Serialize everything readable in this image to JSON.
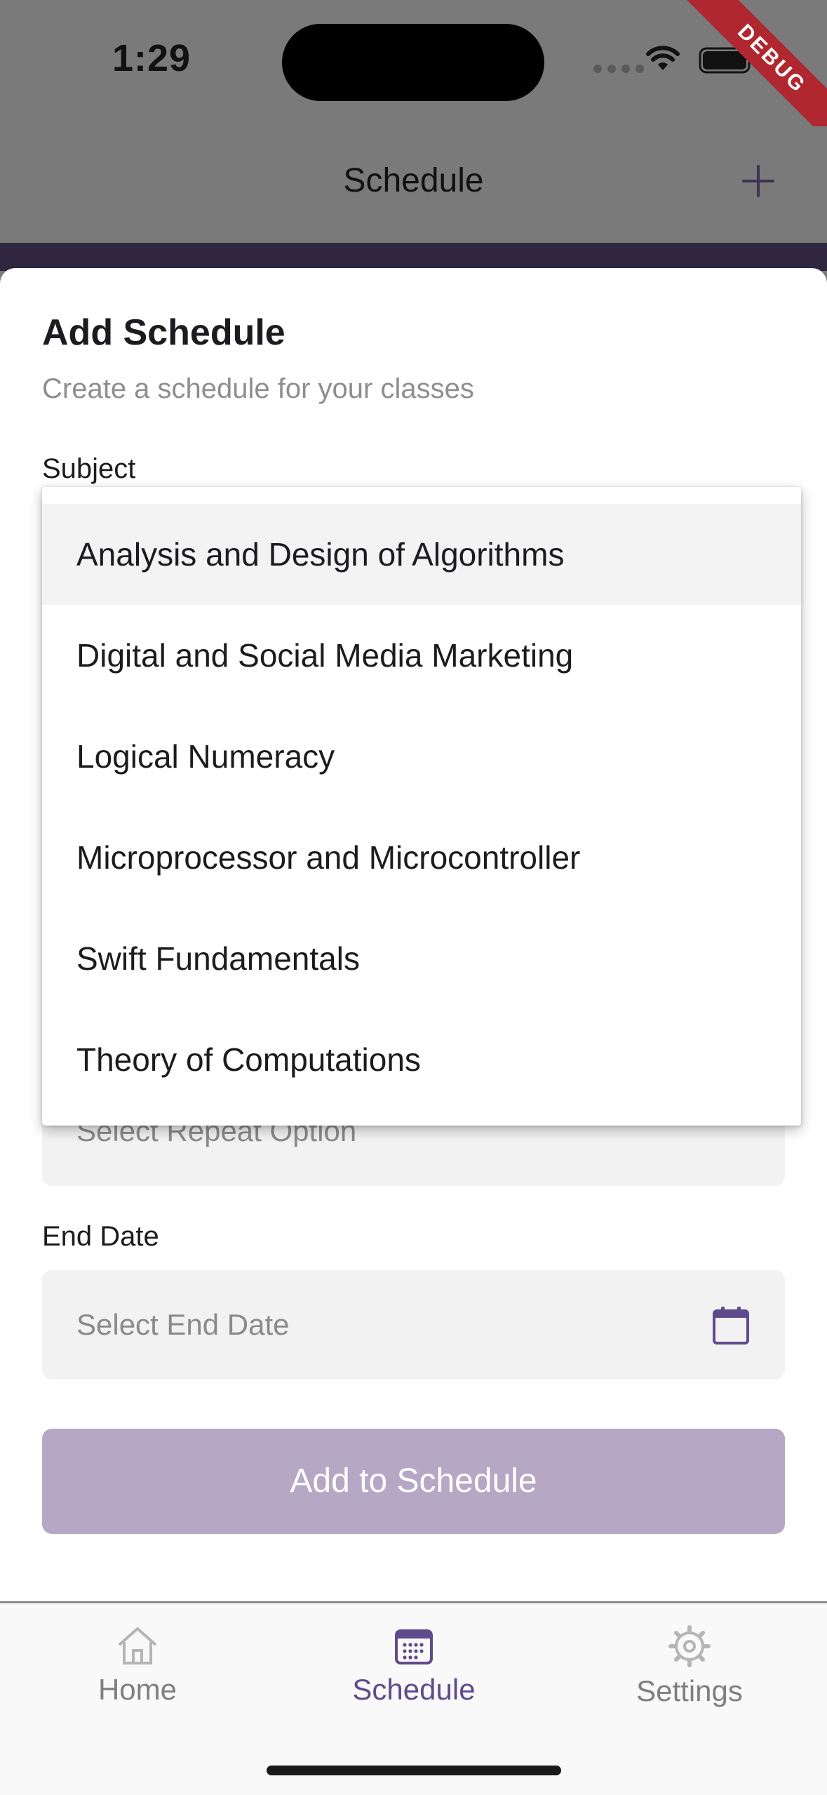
{
  "status_bar": {
    "time": "1:29",
    "debug_label": "DEBUG"
  },
  "app_bar": {
    "title": "Schedule",
    "add_icon": "plus-icon"
  },
  "sheet": {
    "title": "Add Schedule",
    "subtitle": "Create a schedule for your classes",
    "subject_label": "Subject",
    "repeat_placeholder": "Select Repeat Option",
    "end_date_label": "End Date",
    "end_date_placeholder": "Select End Date",
    "submit_label": "Add to Schedule"
  },
  "dropdown": {
    "items": [
      "Analysis and Design of Algorithms",
      "Digital and Social Media Marketing",
      "Logical Numeracy",
      "Microprocessor and Microcontroller",
      "Swift Fundamentals",
      "Theory of Computations"
    ],
    "highlighted_index": 0
  },
  "bottom_nav": {
    "items": [
      {
        "label": "Home",
        "icon": "home-icon",
        "active": false
      },
      {
        "label": "Schedule",
        "icon": "calendar-icon",
        "active": true
      },
      {
        "label": "Settings",
        "icon": "gear-icon",
        "active": false
      }
    ]
  },
  "colors": {
    "accent": "#5e4b8b",
    "button_disabled": "#b6a7c5",
    "scrim": "#7a7a7a"
  }
}
